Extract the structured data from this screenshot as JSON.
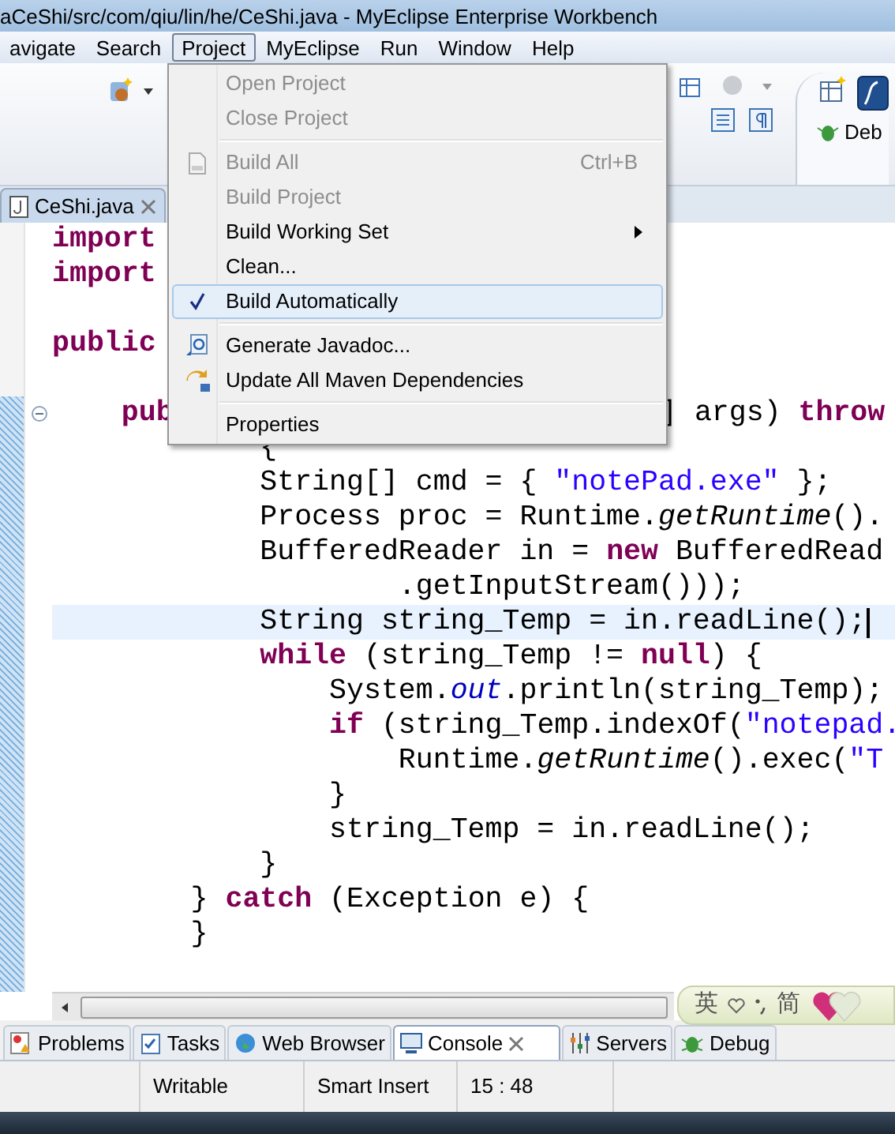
{
  "window": {
    "title": "aCeShi/src/com/qiu/lin/he/CeShi.java - MyEclipse Enterprise Workbench"
  },
  "menu_bar": [
    {
      "label": "avigate",
      "selected": false
    },
    {
      "label": "Search",
      "selected": false
    },
    {
      "label": "Project",
      "selected": true
    },
    {
      "label": "MyEclipse",
      "selected": false
    },
    {
      "label": "Run",
      "selected": false
    },
    {
      "label": "Window",
      "selected": false
    },
    {
      "label": "Help",
      "selected": false
    }
  ],
  "perspective": {
    "label": "Deb"
  },
  "project_menu": [
    {
      "kind": "item",
      "label": "Open Project",
      "disabled": true,
      "checked": false,
      "selected": false
    },
    {
      "kind": "item",
      "label": "Close Project",
      "disabled": true,
      "checked": false,
      "selected": false
    },
    {
      "kind": "separator"
    },
    {
      "kind": "item",
      "label": "Build All",
      "shortcut": "Ctrl+B",
      "disabled": true,
      "checked": false,
      "selected": false
    },
    {
      "kind": "item",
      "label": "Build Project",
      "disabled": true,
      "checked": false,
      "selected": false
    },
    {
      "kind": "item",
      "label": "Build Working Set",
      "submenu": true,
      "disabled": false,
      "checked": false,
      "selected": false
    },
    {
      "kind": "item",
      "label": "Clean...",
      "disabled": false,
      "checked": false,
      "selected": false
    },
    {
      "kind": "item",
      "label": "Build Automatically",
      "disabled": false,
      "checked": true,
      "selected": true
    },
    {
      "kind": "separator"
    },
    {
      "kind": "item",
      "label": "Generate Javadoc...",
      "disabled": false,
      "checked": false,
      "selected": false
    },
    {
      "kind": "item",
      "label": "Update All Maven Dependencies",
      "disabled": false,
      "checked": false,
      "selected": false
    },
    {
      "kind": "separator"
    },
    {
      "kind": "item",
      "label": "Properties",
      "disabled": false,
      "checked": false,
      "selected": false
    }
  ],
  "editor_tab": {
    "label": "CeShi.java",
    "selected": true
  },
  "code_lines": [
    {
      "segments": [
        {
          "kind": "keyword",
          "text": "import"
        }
      ]
    },
    {
      "segments": [
        {
          "kind": "keyword",
          "text": "import"
        }
      ]
    },
    {
      "kind": "blank"
    },
    {
      "segments": [
        {
          "kind": "keyword",
          "text": "public"
        }
      ]
    },
    {
      "kind": "blank"
    },
    {
      "segments": [
        {
          "kind": "keyword",
          "text": "    pub"
        }
      ],
      "after_menu": [
        {
          "kind": "plain",
          "text": "] args) "
        },
        {
          "kind": "keyword",
          "text": "throw"
        }
      ],
      "folded": false
    },
    {
      "segments": [
        {
          "kind": "plain",
          "text": "            {"
        }
      ]
    },
    {
      "segments": [
        {
          "kind": "plain",
          "text": "            String[] cmd = { "
        },
        {
          "kind": "string",
          "text": "\"notePad.exe\""
        },
        {
          "kind": "plain",
          "text": " };"
        }
      ]
    },
    {
      "segments": [
        {
          "kind": "plain",
          "text": "            Process proc = Runtime."
        },
        {
          "kind": "static",
          "text": "getRuntime"
        },
        {
          "kind": "plain",
          "text": "()."
        }
      ]
    },
    {
      "segments": [
        {
          "kind": "plain",
          "text": "            BufferedReader in = "
        },
        {
          "kind": "keyword",
          "text": "new"
        },
        {
          "kind": "plain",
          "text": " BufferedRead"
        }
      ]
    },
    {
      "segments": [
        {
          "kind": "plain",
          "text": "                    .getInputStream()));"
        }
      ]
    },
    {
      "segments": [
        {
          "kind": "plain",
          "text": "            String string_Temp = in.readLine();"
        }
      ],
      "current": true
    },
    {
      "segments": [
        {
          "kind": "keyword",
          "text": "            while"
        },
        {
          "kind": "plain",
          "text": " (string_Temp != "
        },
        {
          "kind": "keyword",
          "text": "null"
        },
        {
          "kind": "plain",
          "text": ") {"
        }
      ]
    },
    {
      "segments": [
        {
          "kind": "plain",
          "text": "                System."
        },
        {
          "kind": "field",
          "text": "out"
        },
        {
          "kind": "plain",
          "text": ".println(string_Temp);"
        }
      ]
    },
    {
      "segments": [
        {
          "kind": "keyword",
          "text": "                if"
        },
        {
          "kind": "plain",
          "text": " (string_Temp.indexOf("
        },
        {
          "kind": "string",
          "text": "\"notepad."
        }
      ]
    },
    {
      "segments": [
        {
          "kind": "plain",
          "text": "                    Runtime."
        },
        {
          "kind": "static",
          "text": "getRuntime"
        },
        {
          "kind": "plain",
          "text": "().exec("
        },
        {
          "kind": "string",
          "text": "\"T"
        }
      ]
    },
    {
      "segments": [
        {
          "kind": "plain",
          "text": "                }"
        }
      ]
    },
    {
      "segments": [
        {
          "kind": "plain",
          "text": "                string_Temp = in.readLine();"
        }
      ]
    },
    {
      "segments": [
        {
          "kind": "plain",
          "text": "            }"
        }
      ]
    },
    {
      "segments": [
        {
          "kind": "plain",
          "text": "        } "
        },
        {
          "kind": "keyword",
          "text": "catch"
        },
        {
          "kind": "plain",
          "text": " (Exception e) {"
        }
      ]
    },
    {
      "segments": [
        {
          "kind": "plain",
          "text": "        }"
        }
      ]
    }
  ],
  "ime_bar": {
    "language": "英",
    "mode": "简"
  },
  "bottom_tabs": [
    {
      "label": "Problems",
      "selected": false
    },
    {
      "label": "Tasks",
      "selected": false
    },
    {
      "label": "Web Browser",
      "selected": false
    },
    {
      "label": "Console",
      "selected": true
    },
    {
      "label": "Servers",
      "selected": false
    },
    {
      "label": "Debug",
      "selected": false
    }
  ],
  "status_bar": [
    "Writable",
    "Smart Insert",
    "15 : 48"
  ]
}
